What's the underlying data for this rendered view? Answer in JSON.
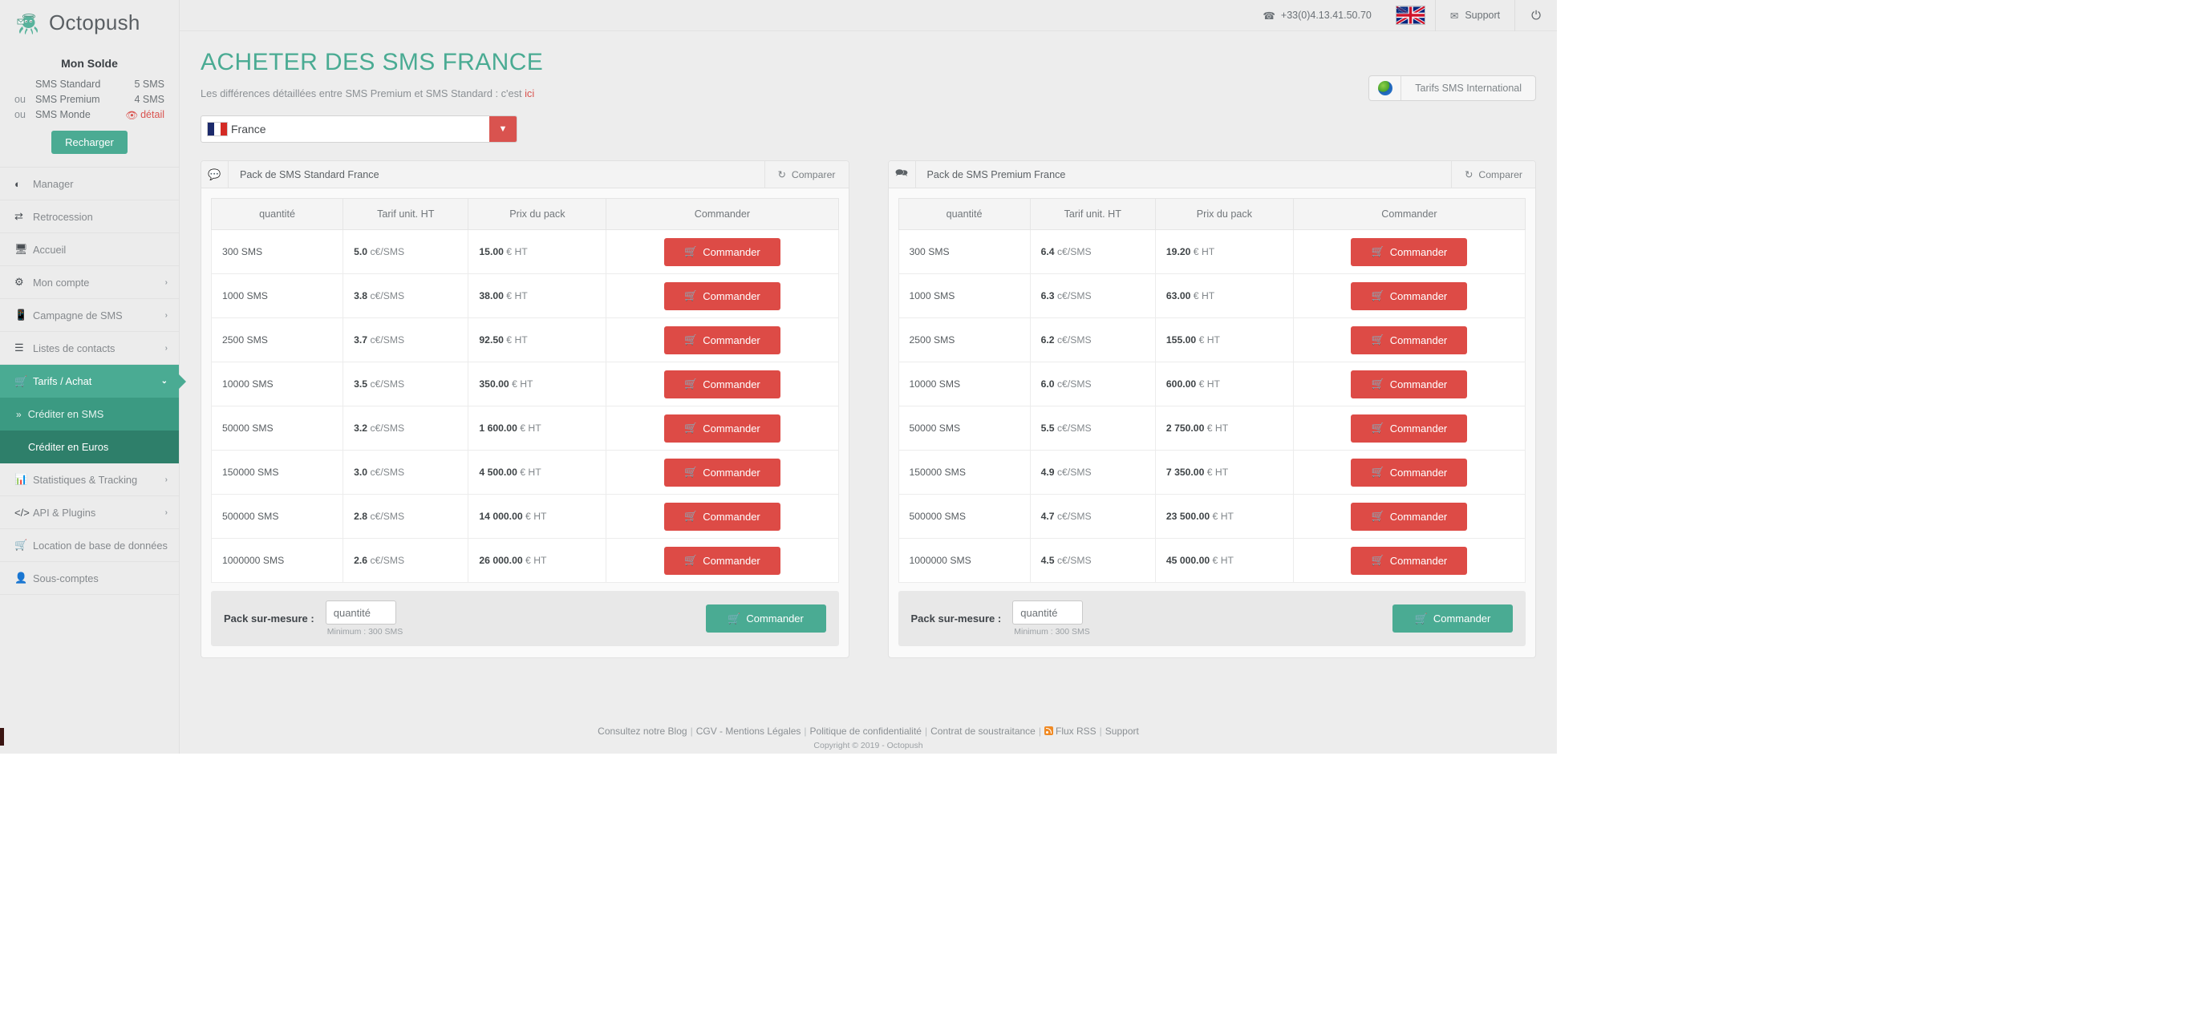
{
  "brand": {
    "name": "Octopush",
    "logo_icon": "octopus-icon"
  },
  "balance": {
    "title": "Mon Solde",
    "rows": [
      {
        "prefix": "",
        "label": "SMS Standard",
        "value": "5 SMS"
      },
      {
        "prefix": "ou",
        "label": "SMS Premium",
        "value": "4 SMS"
      },
      {
        "prefix": "ou",
        "label": "SMS Monde",
        "value": "détail"
      }
    ],
    "detail_link": "détail",
    "recharge_label": "Recharger"
  },
  "sidebar": {
    "items": [
      {
        "label": "Manager",
        "icon": "dashboard-icon",
        "caret": ""
      },
      {
        "label": "Retrocession",
        "icon": "exchange-icon",
        "caret": ""
      },
      {
        "label": "Accueil",
        "icon": "desktop-icon",
        "caret": ""
      },
      {
        "label": "Mon compte",
        "icon": "gear-icon",
        "caret": "›"
      },
      {
        "label": "Campagne de SMS",
        "icon": "mobile-icon",
        "caret": "›"
      },
      {
        "label": "Listes de contacts",
        "icon": "list-icon",
        "caret": "›"
      },
      {
        "label": "Tarifs / Achat",
        "icon": "cart-icon",
        "caret": "⌄",
        "active": true
      },
      {
        "label": "Statistiques & Tracking",
        "icon": "bar-chart-icon",
        "caret": "›"
      },
      {
        "label": "API & Plugins",
        "icon": "code-icon",
        "caret": "›"
      },
      {
        "label": "Location de base de données",
        "icon": "cart-icon",
        "caret": ""
      },
      {
        "label": "Sous-comptes",
        "icon": "user-icon",
        "caret": ""
      }
    ],
    "subitems": [
      {
        "label": "Créditer en SMS",
        "selected": false
      },
      {
        "label": "Créditer en Euros",
        "selected": true
      }
    ]
  },
  "topbar": {
    "phone": "+33(0)4.13.41.50.70",
    "phone_icon": "phone-icon",
    "flag_icon": "uk-flag-icon",
    "support_label": "Support",
    "support_icon": "envelope-icon",
    "power_icon": "power-icon"
  },
  "page": {
    "title": "ACHETER DES SMS FRANCE",
    "subtitle_prefix": "Les différences détaillées entre SMS Premium et SMS Standard : c'est ",
    "subtitle_link": "ici",
    "international_button": "Tarifs SMS International",
    "international_icon": "globe-icon",
    "country_value": "France",
    "country_flag": "france-flag-icon",
    "country_caret_icon": "chevron-down-icon"
  },
  "table_headers": [
    "quantité",
    "Tarif unit. HT",
    "Prix du pack",
    "Commander"
  ],
  "order_button_label": "Commander",
  "order_button_icon": "cart-icon",
  "compare_label": "Comparer",
  "compare_icon": "refresh-icon",
  "custom_pack": {
    "label": "Pack sur-mesure :",
    "placeholder": "quantité",
    "hint": "Minimum : 300 SMS",
    "button_label": "Commander"
  },
  "panels": [
    {
      "title": "Pack de SMS Standard France",
      "icon": "comment-icon",
      "rows": [
        {
          "qty": "300 SMS",
          "unit": "5.0",
          "unit_suffix": "c€/SMS",
          "price": "15.00",
          "price_suffix": "€ HT"
        },
        {
          "qty": "1000 SMS",
          "unit": "3.8",
          "unit_suffix": "c€/SMS",
          "price": "38.00",
          "price_suffix": "€ HT"
        },
        {
          "qty": "2500 SMS",
          "unit": "3.7",
          "unit_suffix": "c€/SMS",
          "price": "92.50",
          "price_suffix": "€ HT"
        },
        {
          "qty": "10000 SMS",
          "unit": "3.5",
          "unit_suffix": "c€/SMS",
          "price": "350.00",
          "price_suffix": "€ HT"
        },
        {
          "qty": "50000 SMS",
          "unit": "3.2",
          "unit_suffix": "c€/SMS",
          "price": "1 600.00",
          "price_suffix": "€ HT"
        },
        {
          "qty": "150000 SMS",
          "unit": "3.0",
          "unit_suffix": "c€/SMS",
          "price": "4 500.00",
          "price_suffix": "€ HT"
        },
        {
          "qty": "500000 SMS",
          "unit": "2.8",
          "unit_suffix": "c€/SMS",
          "price": "14 000.00",
          "price_suffix": "€ HT"
        },
        {
          "qty": "1000000 SMS",
          "unit": "2.6",
          "unit_suffix": "c€/SMS",
          "price": "26 000.00",
          "price_suffix": "€ HT"
        }
      ]
    },
    {
      "title": "Pack de SMS Premium France",
      "icon": "comments-icon",
      "rows": [
        {
          "qty": "300 SMS",
          "unit": "6.4",
          "unit_suffix": "c€/SMS",
          "price": "19.20",
          "price_suffix": "€ HT"
        },
        {
          "qty": "1000 SMS",
          "unit": "6.3",
          "unit_suffix": "c€/SMS",
          "price": "63.00",
          "price_suffix": "€ HT"
        },
        {
          "qty": "2500 SMS",
          "unit": "6.2",
          "unit_suffix": "c€/SMS",
          "price": "155.00",
          "price_suffix": "€ HT"
        },
        {
          "qty": "10000 SMS",
          "unit": "6.0",
          "unit_suffix": "c€/SMS",
          "price": "600.00",
          "price_suffix": "€ HT"
        },
        {
          "qty": "50000 SMS",
          "unit": "5.5",
          "unit_suffix": "c€/SMS",
          "price": "2 750.00",
          "price_suffix": "€ HT"
        },
        {
          "qty": "150000 SMS",
          "unit": "4.9",
          "unit_suffix": "c€/SMS",
          "price": "7 350.00",
          "price_suffix": "€ HT"
        },
        {
          "qty": "500000 SMS",
          "unit": "4.7",
          "unit_suffix": "c€/SMS",
          "price": "23 500.00",
          "price_suffix": "€ HT"
        },
        {
          "qty": "1000000 SMS",
          "unit": "4.5",
          "unit_suffix": "c€/SMS",
          "price": "45 000.00",
          "price_suffix": "€ HT"
        }
      ]
    }
  ],
  "footer": {
    "links": [
      "Consultez notre Blog",
      "CGV - Mentions Légales",
      "Politique de confidentialité",
      "Contrat de soustraitance",
      "Flux RSS",
      "Support"
    ],
    "rss_icon": "rss-icon",
    "copyright": "Copyright © 2019 - Octopush"
  },
  "colors": {
    "accent_green": "#4aab93",
    "accent_red": "#dd4b46",
    "sidebar_bg": "#ececec",
    "sub_active": "#2e7f6a"
  }
}
